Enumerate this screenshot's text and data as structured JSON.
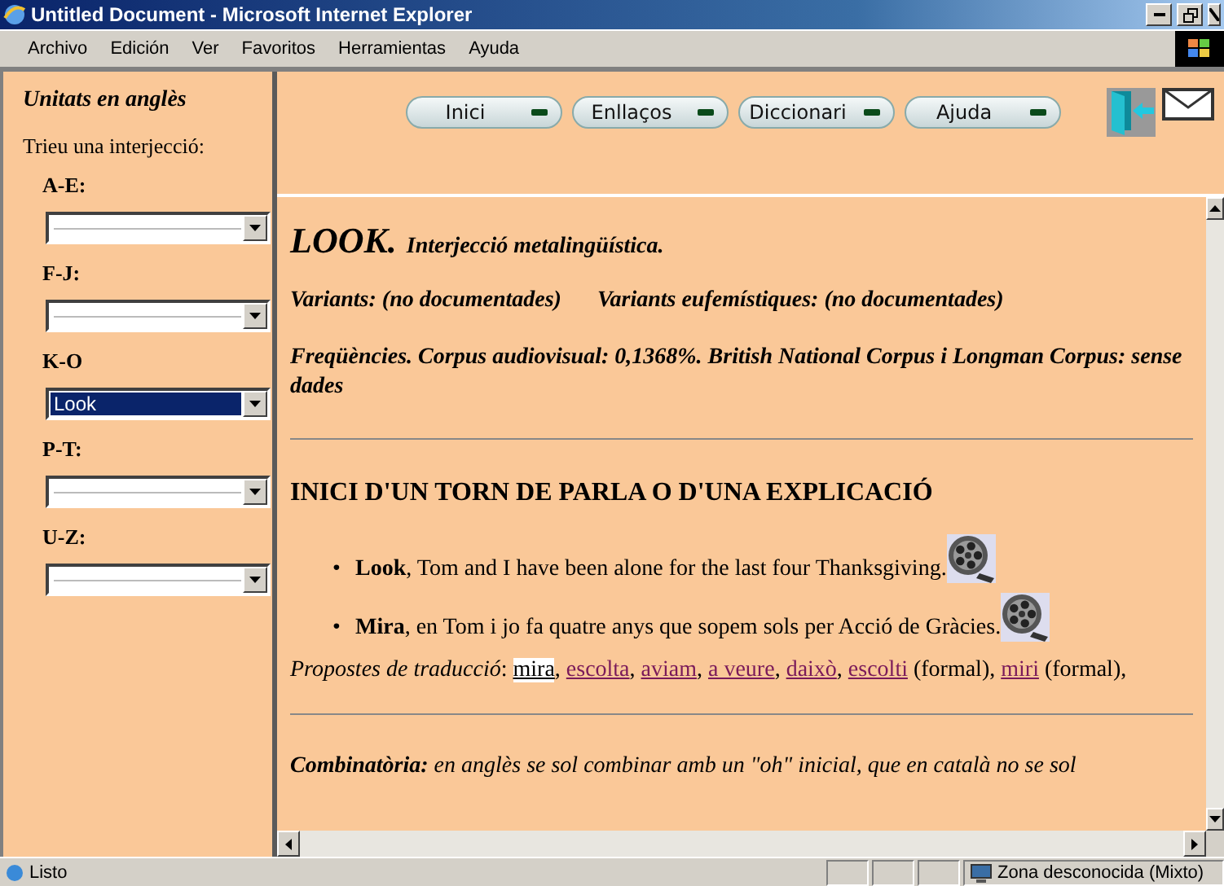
{
  "window": {
    "title": "Untitled Document - Microsoft Internet Explorer"
  },
  "menu": [
    "Archivo",
    "Edición",
    "Ver",
    "Favoritos",
    "Herramientas",
    "Ayuda"
  ],
  "sidebar": {
    "title": "Unitats en anglès",
    "prompt": "Trieu una interjecció:",
    "selects": [
      {
        "label": "A-E:",
        "focused": false
      },
      {
        "label": "F-J:",
        "focused": false
      },
      {
        "label": "K-O",
        "value": "Look",
        "focused": true
      },
      {
        "label": "P-T:",
        "focused": false
      },
      {
        "label": "U-Z:",
        "focused": false
      }
    ]
  },
  "nav": [
    "Inici",
    "Enllaços",
    "Diccionari",
    "Ajuda"
  ],
  "content": {
    "headword": "LOOK.",
    "category": "Interjecció metalingüística.",
    "variants": "Variants: (no documentades)",
    "euphemisms": "Variants eufemístiques: (no documentades)",
    "frequencies": "Freqüències. Corpus audiovisual: 0,1368%. British National Corpus i Longman Corpus: sense dades",
    "heading": "INICI D'UN TORN DE PARLA O D'UNA EXPLICACIÓ",
    "examples": [
      {
        "bullet": "•",
        "text": "**Look**, Tom and I have been alone for the last four Thanksgiving."
      },
      {
        "bullet": "•",
        "text": "**Mira**, en Tom i jo fa quatre anys que sopem sols per Acció de Gràcies."
      }
    ],
    "proposals": {
      "label": "Propostes de traducció",
      "after_label": ": ",
      "links": [
        {
          "text": "mira",
          "highlighted": true,
          "after": ", "
        },
        {
          "text": "escolta",
          "highlighted": false,
          "after": ", "
        },
        {
          "text": "aviam",
          "highlighted": false,
          "after": ", "
        },
        {
          "text": "a veure",
          "highlighted": false,
          "after": ", "
        },
        {
          "text": "daixò",
          "highlighted": false,
          "after": ", "
        },
        {
          "text": "escolti",
          "highlighted": false,
          "after": " (formal), "
        },
        {
          "text": "miri",
          "highlighted": false,
          "after": " (formal),"
        }
      ]
    },
    "combinatorics": "**Combinatòria:** en anglès se sol combinar amb un \"oh\" inicial, que en català no se sol"
  },
  "status_bar": {
    "text": "Listo",
    "zone": "Zona desconocida (Mixto)"
  }
}
